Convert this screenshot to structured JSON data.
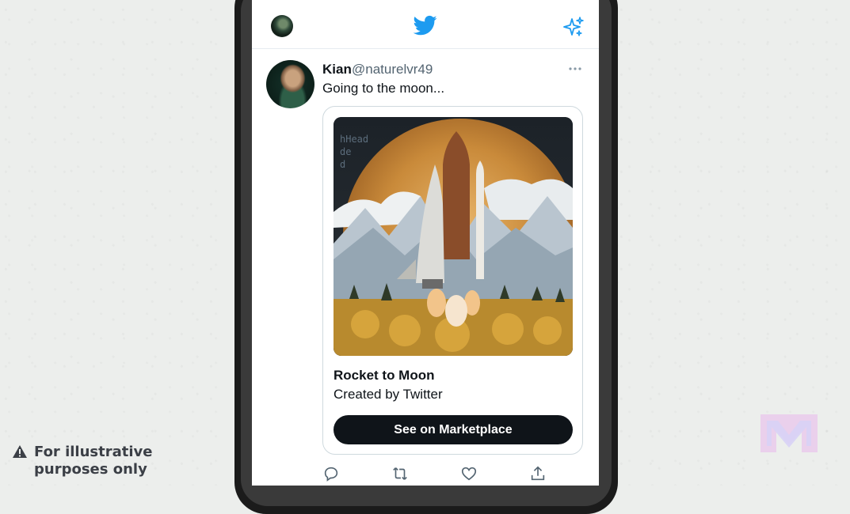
{
  "header": {
    "logo_icon": "twitter-bird-icon",
    "sparkle_icon": "sparkle-icon",
    "brand_color": "#1d9bf0"
  },
  "tweet": {
    "author_name": "Kian",
    "author_handle": "@naturelvr49",
    "text": "Going to the moon...",
    "more_icon": "more-icon"
  },
  "card": {
    "image_code_text": "hHead\nde\nd",
    "title": "Rocket to Moon",
    "subtitle": "Created by Twitter",
    "button_label": "See on Marketplace"
  },
  "actions": [
    "reply-icon",
    "retweet-icon",
    "like-icon",
    "share-icon"
  ],
  "disclaimer": {
    "line1": "For illustrative",
    "line2": "purposes only"
  }
}
